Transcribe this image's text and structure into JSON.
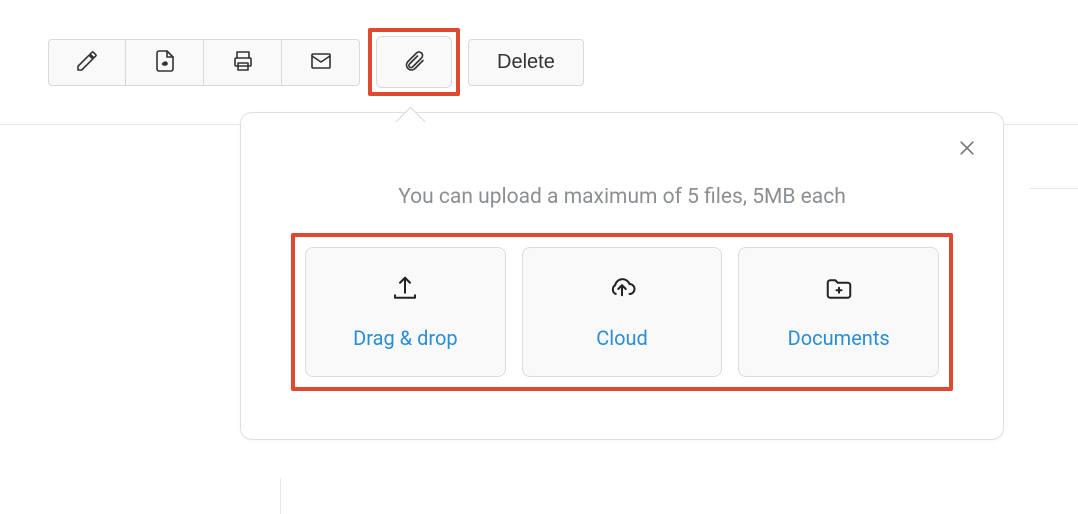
{
  "toolbar": {
    "edit_icon": "pencil-icon",
    "pdf_icon": "pdf-icon",
    "print_icon": "printer-icon",
    "mail_icon": "mail-icon",
    "attach_icon": "paperclip-icon",
    "delete_label": "Delete"
  },
  "popover": {
    "close_icon": "close-icon",
    "hint": "You can upload a maximum of 5 files, 5MB each",
    "options": [
      {
        "icon": "upload-icon",
        "label": "Drag & drop"
      },
      {
        "icon": "cloud-upload-icon",
        "label": "Cloud"
      },
      {
        "icon": "folder-add-icon",
        "label": "Documents"
      }
    ]
  }
}
